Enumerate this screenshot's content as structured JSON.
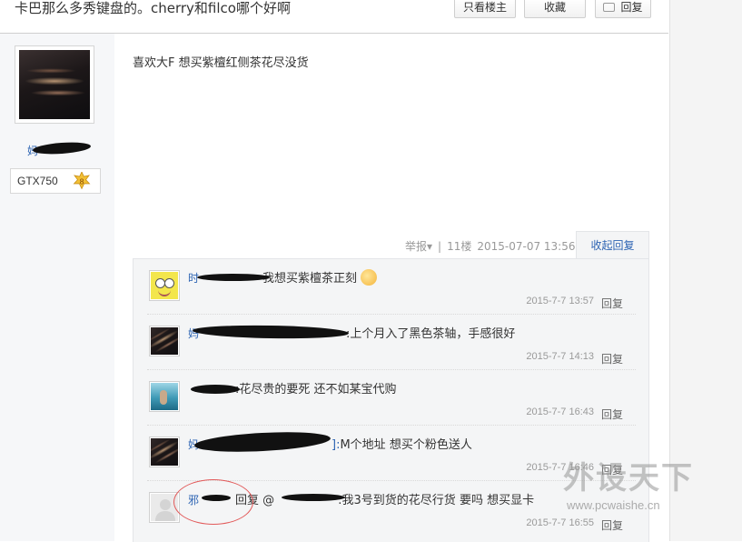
{
  "thread": {
    "title": "卡巴那么多秀键盘的。cherry和filco哪个好啊",
    "only_author_label": "只看楼主",
    "favorite_label": "收藏",
    "reply_label": "回复"
  },
  "author": {
    "name_visible": "妈",
    "level_name": "GTX750",
    "level": "8"
  },
  "post": {
    "body": "喜欢大F 想买紫檀红侧茶花尽没货",
    "report_label": "举报▾",
    "separator": "|",
    "floor": "11楼",
    "timestamp": "2015-07-07 13:56",
    "collapse_label": "收起回复"
  },
  "comments": [
    {
      "user": "时",
      "text": "我想买紫檀茶正刻",
      "time": "2015-7-7 13:57",
      "reply": "回复",
      "avatar": "spongebob-avatar"
    },
    {
      "user": "妈",
      "text": ":上个月入了黑色茶轴，手感很好",
      "time": "2015-7-7 14:13",
      "reply": "回复",
      "avatar": "scratch-avatar"
    },
    {
      "user": "",
      "text": ":花尽贵的要死 还不如某宝代购",
      "time": "2015-7-7 16:43",
      "reply": "回复",
      "avatar": "water-avatar"
    },
    {
      "user": "妈",
      "text": "M个地址 想买个粉色送人",
      "time": "2015-7-7 16:46",
      "reply": "回复",
      "avatar": "scratch-avatar"
    },
    {
      "user": "邪",
      "prefix": "回复 @",
      "text": ":我3号到货的花尽行货 要吗 想买显卡",
      "time": "2015-7-7 16:55",
      "reply": "回复",
      "avatar": "default-avatar"
    }
  ],
  "watermark": {
    "logo": "外设天下",
    "url": "www.pcwaishe.cn"
  },
  "colors": {
    "link": "#2d64b3",
    "muted": "#999999",
    "annotation": "#e25a5a"
  }
}
